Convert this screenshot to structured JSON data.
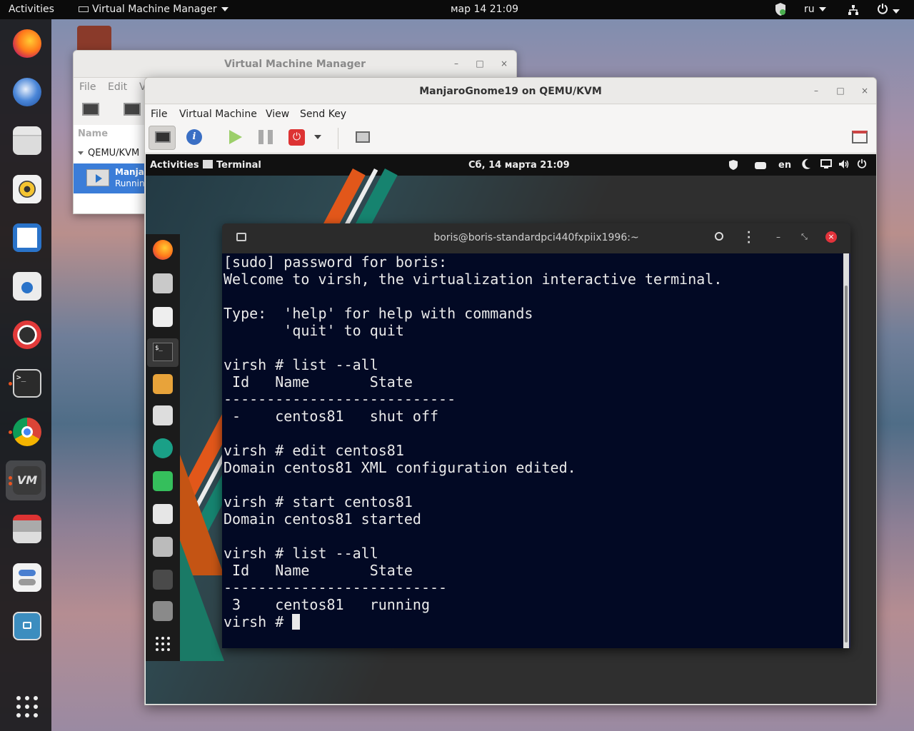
{
  "host": {
    "topbar": {
      "activities": "Activities",
      "app_menu": "Virtual Machine Manager",
      "clock": "мар 14  21:09",
      "language": "ru"
    },
    "dock": [
      "firefox-icon",
      "thunderbird-icon",
      "files-icon",
      "rhythmbox-icon",
      "libreoffice-writer-icon",
      "software-center-icon",
      "help-icon",
      "terminal-icon",
      "chrome-icon",
      "virt-manager-icon",
      "transmission-icon",
      "settings-icon",
      "screenshot-icon",
      "show-apps-icon"
    ]
  },
  "vmm": {
    "title": "Virtual Machine Manager",
    "menu": [
      "File",
      "Edit",
      "V"
    ],
    "list_header": "Name",
    "connection": "QEMU/KVM",
    "vm_name": "Manjar",
    "vm_status": "Runnin"
  },
  "viewer": {
    "title": "ManjaroGnome19 on QEMU/KVM",
    "menu": [
      "File",
      "Virtual Machine",
      "View",
      "Send Key"
    ]
  },
  "guest": {
    "topbar": {
      "activities": "Activities",
      "app": "Terminal",
      "clock": "Сб, 14 марта  21:09",
      "language": "en"
    },
    "terminal": {
      "title": "boris@boris-standardpci440fxpiix1996:~",
      "output": "[sudo] password for boris:\nWelcome to virsh, the virtualization interactive terminal.\n\nType:  'help' for help with commands\n       'quit' to quit\n\nvirsh # list --all\n Id   Name       State\n---------------------------\n -    centos81   shut off\n\nvirsh # edit centos81\nDomain centos81 XML configuration edited.\n\nvirsh # start centos81\nDomain centos81 started\n\nvirsh # list --all\n Id   Name       State\n--------------------------\n 3    centos81   running\n",
      "prompt": "virsh # "
    }
  },
  "colors": {
    "terminal_bg": "#020924",
    "host_topbar": "#0b0b0b",
    "guest_topbar": "#111111",
    "accent_orange": "#e95420"
  }
}
